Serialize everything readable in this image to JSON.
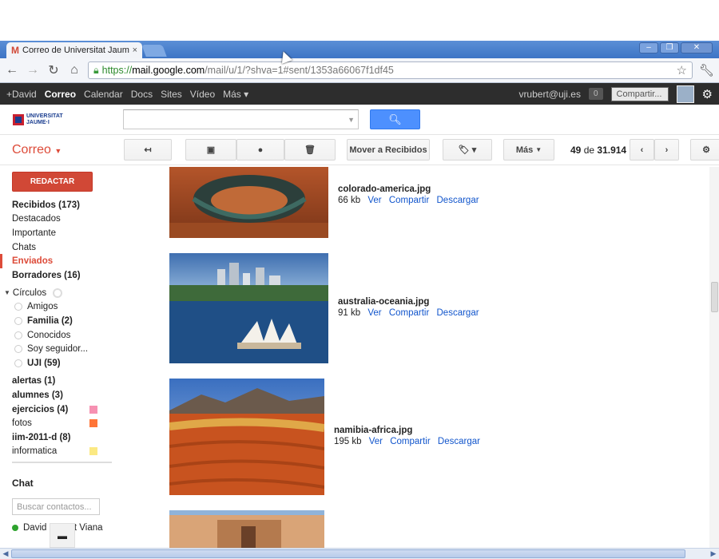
{
  "browser": {
    "tab_title": "Correo de Universitat Jaume I",
    "tab_close": "×",
    "url_https": "https://",
    "url_host": "mail.google.com",
    "url_rest": "/mail/u/1/?shva=1#sent/1353a66067f1df45"
  },
  "gbar": {
    "links": [
      "+David",
      "Correo",
      "Calendar",
      "Docs",
      "Sites",
      "Vídeo",
      "Más ▾"
    ],
    "email": "vrubert@uji.es",
    "notifications": "0",
    "share": "Compartir..."
  },
  "logo": {
    "line1": "UNIVERSITAT",
    "line2": "JAUME·I"
  },
  "toolbar": {
    "app_name": "Correo",
    "move_inbox": "Mover a Recibidos",
    "more": "Más",
    "page_current": "49",
    "page_of": "de",
    "page_total": "31.914"
  },
  "sidebar": {
    "compose": "REDACTAR",
    "items": [
      {
        "label": "Recibidos (173)"
      },
      {
        "label": "Destacados"
      },
      {
        "label": "Importante"
      },
      {
        "label": "Chats"
      },
      {
        "label": "Enviados"
      },
      {
        "label": "Borradores (16)"
      }
    ],
    "circles_label": "Círculos",
    "circles": [
      {
        "label": "Amigos"
      },
      {
        "label": "Familia (2)"
      },
      {
        "label": "Conocidos"
      },
      {
        "label": "Soy seguidor..."
      },
      {
        "label": "UJI (59)"
      }
    ],
    "labels": [
      {
        "label": "alertas (1)",
        "color": ""
      },
      {
        "label": "alumnes (3)",
        "color": ""
      },
      {
        "label": "ejercicios (4)",
        "color": "#f691b2"
      },
      {
        "label": "fotos",
        "color": "#ff7537"
      },
      {
        "label": "iim-2011-d (8)",
        "color": ""
      },
      {
        "label": "informatica",
        "color": "#fbe983"
      }
    ],
    "chat_title": "Chat",
    "chat_search_placeholder": "Buscar contactos...",
    "contact": "David Rubert Viana"
  },
  "attachments": [
    {
      "name": "colorado-america.jpg",
      "size": "66 kb",
      "view": "Ver",
      "share": "Compartir",
      "download": "Descargar"
    },
    {
      "name": "australia-oceania.jpg",
      "size": "91 kb",
      "view": "Ver",
      "share": "Compartir",
      "download": "Descargar"
    },
    {
      "name": "namibia-africa.jpg",
      "size": "195 kb",
      "view": "Ver",
      "share": "Compartir",
      "download": "Descargar"
    }
  ]
}
